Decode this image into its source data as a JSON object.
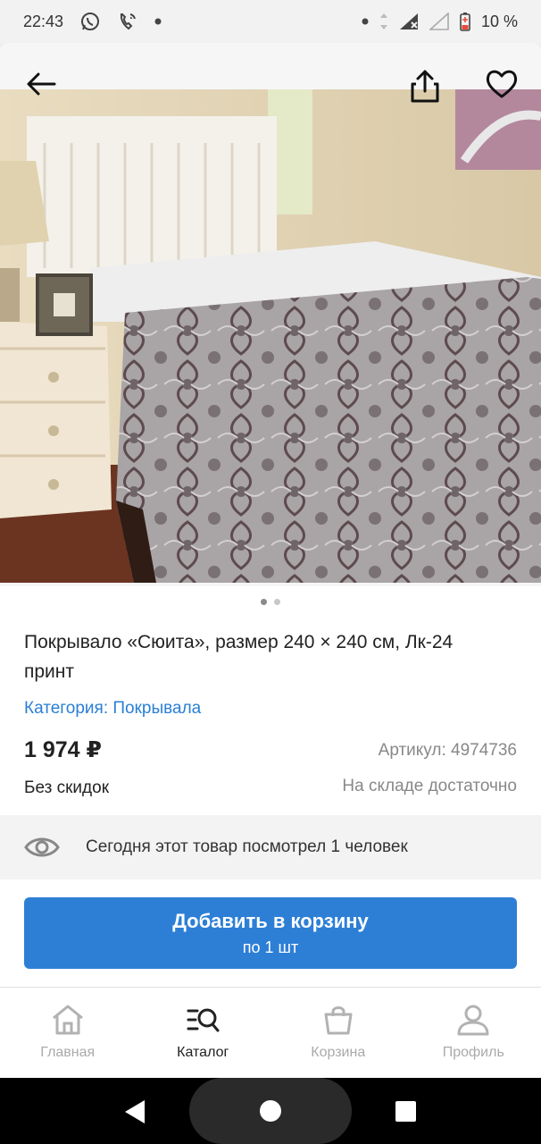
{
  "status_bar": {
    "time": "22:43",
    "battery": "10 %"
  },
  "product": {
    "title": "Покрывало «Сюита», размер 240 × 240 см, Лк-24 принт",
    "category": "Категория: Покрывала",
    "price": "1 974 ₽",
    "sku": "Артикул: 4974736",
    "discount": "Без скидок",
    "stock": "На складе достаточно"
  },
  "gallery": {
    "total": 2,
    "active": 1
  },
  "views_text": "Сегодня этот товар посмотрел 1 человек",
  "cart_button": {
    "label": "Добавить в корзину",
    "sub": "по 1 шт"
  },
  "nav": [
    {
      "label": "Главная",
      "icon": "home-icon",
      "active": false
    },
    {
      "label": "Каталог",
      "icon": "catalog-search-icon",
      "active": true
    },
    {
      "label": "Корзина",
      "icon": "cart-bag-icon",
      "active": false
    },
    {
      "label": "Профиль",
      "icon": "profile-icon",
      "active": false
    }
  ],
  "colors": {
    "accent": "#2d7fd6",
    "link": "#2a7fd4",
    "muted": "#888888"
  }
}
